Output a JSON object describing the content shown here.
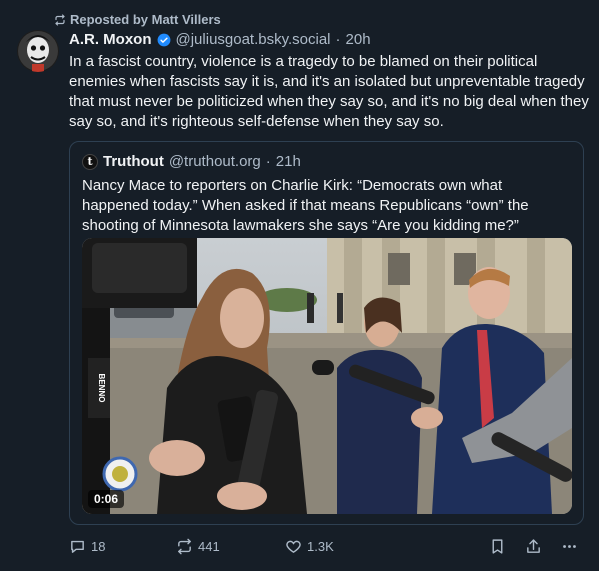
{
  "repost": {
    "label": "Reposted by Matt Villers",
    "icon": "repost-icon"
  },
  "post": {
    "author_name": "A.R. Moxon",
    "verified": true,
    "handle": "@juliusgoat.bsky.social",
    "separator": "·",
    "time": "20h",
    "text": "In a fascist country, violence is a tragedy to be blamed on their political enemies when fascists say it is, and it's an isolated but unpreventable tragedy that must never be politicized when they say so, and it's no big deal when they say so, and it's righteous self-defense when they say so."
  },
  "quote": {
    "avatar_letter": "t",
    "author_name": "Truthout",
    "handle": "@truthout.org",
    "separator": "·",
    "time": "21h",
    "text": "Nancy Mace to reporters on Charlie Kirk: “Democrats own what happened today.” When asked if that means Republicans “own” the shooting of Minnesota lawmakers she says “Are you kidding me?”",
    "video": {
      "duration": "0:06",
      "mic_flag_text": "BENNO"
    }
  },
  "actions": {
    "replies": "18",
    "reposts": "441",
    "likes": "1.3K"
  },
  "colors": {
    "background": "#161e27",
    "text": "#f1f3f5",
    "muted": "#aebbc9",
    "border": "#2e4052",
    "verified": "#208bfe"
  }
}
